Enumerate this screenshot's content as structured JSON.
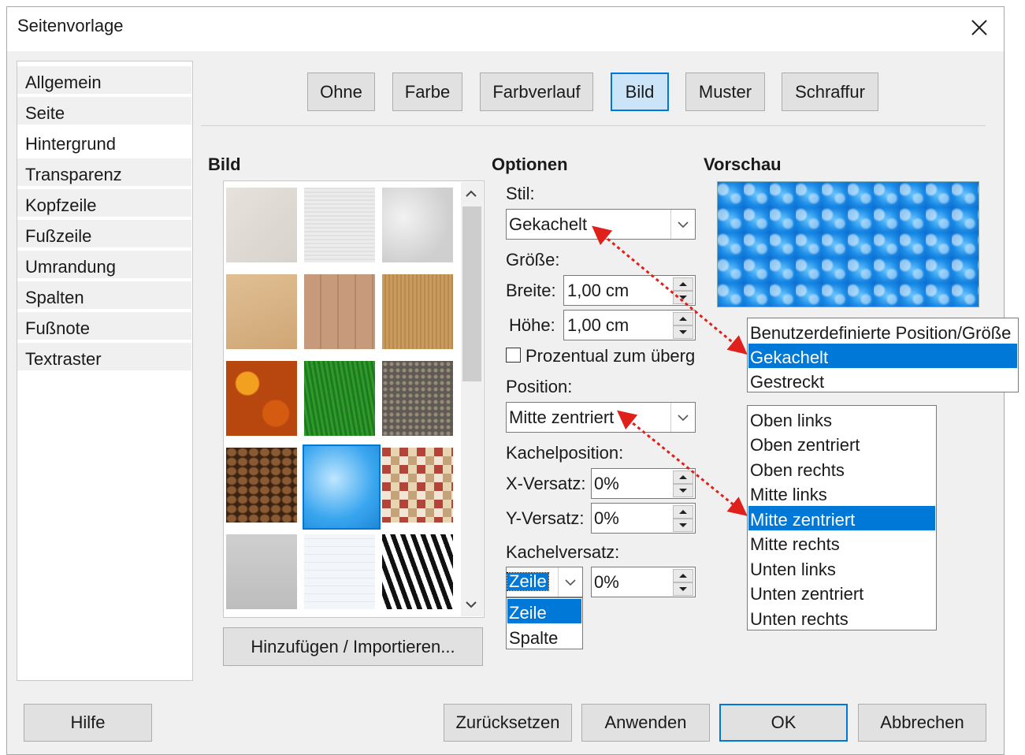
{
  "window": {
    "title": "Seitenvorlage"
  },
  "sidebar": {
    "items": [
      {
        "label": "Allgemein"
      },
      {
        "label": "Seite"
      },
      {
        "label": "Hintergrund"
      },
      {
        "label": "Transparenz"
      },
      {
        "label": "Kopfzeile"
      },
      {
        "label": "Fußzeile"
      },
      {
        "label": "Umrandung"
      },
      {
        "label": "Spalten"
      },
      {
        "label": "Fußnote"
      },
      {
        "label": "Textraster"
      }
    ],
    "selected": "Hintergrund"
  },
  "fill_tabs": {
    "items": [
      {
        "label": "Ohne"
      },
      {
        "label": "Farbe"
      },
      {
        "label": "Farbverlauf"
      },
      {
        "label": "Bild"
      },
      {
        "label": "Muster"
      },
      {
        "label": "Schraffur"
      }
    ],
    "active": "Bild"
  },
  "image_section": {
    "heading": "Bild",
    "add_button": "Hinzufügen / Importieren...",
    "selected_tile": 10
  },
  "options": {
    "heading": "Optionen",
    "style_label": "Stil:",
    "style_value": "Gekachelt",
    "size_label": "Größe:",
    "width_label": "Breite:",
    "width_value": "1,00 cm",
    "height_label": "Höhe:",
    "height_value": "1,00 cm",
    "relative_checkbox": "Prozentual zum überg",
    "relative_checked": false,
    "position_label": "Position:",
    "position_value": "Mitte zentriert",
    "tile_position_label": "Kachelposition:",
    "x_offset_label": "X-Versatz:",
    "x_offset_value": "0%",
    "y_offset_label": "Y-Versatz:",
    "y_offset_value": "0%",
    "tile_offset_label": "Kachelversatz:",
    "tile_offset_mode": "Zeile",
    "tile_offset_value": "0%",
    "tile_offset_options": [
      "Zeile",
      "Spalte"
    ]
  },
  "preview": {
    "heading": "Vorschau"
  },
  "style_dropdown_options": [
    "Benutzerdefinierte Position/Größe",
    "Gekachelt",
    "Gestreckt"
  ],
  "style_dropdown_selected": "Gekachelt",
  "position_dropdown_options": [
    "Oben links",
    "Oben zentriert",
    "Oben rechts",
    "Mitte links",
    "Mitte zentriert",
    "Mitte rechts",
    "Unten links",
    "Unten zentriert",
    "Unten rechts"
  ],
  "position_dropdown_selected": "Mitte zentriert",
  "footer": {
    "help": "Hilfe",
    "reset": "Zurücksetzen",
    "apply": "Anwenden",
    "ok": "OK",
    "cancel": "Abbrechen"
  },
  "colors": {
    "accent": "#0078d7",
    "annotation_arrow": "#e0201b"
  }
}
